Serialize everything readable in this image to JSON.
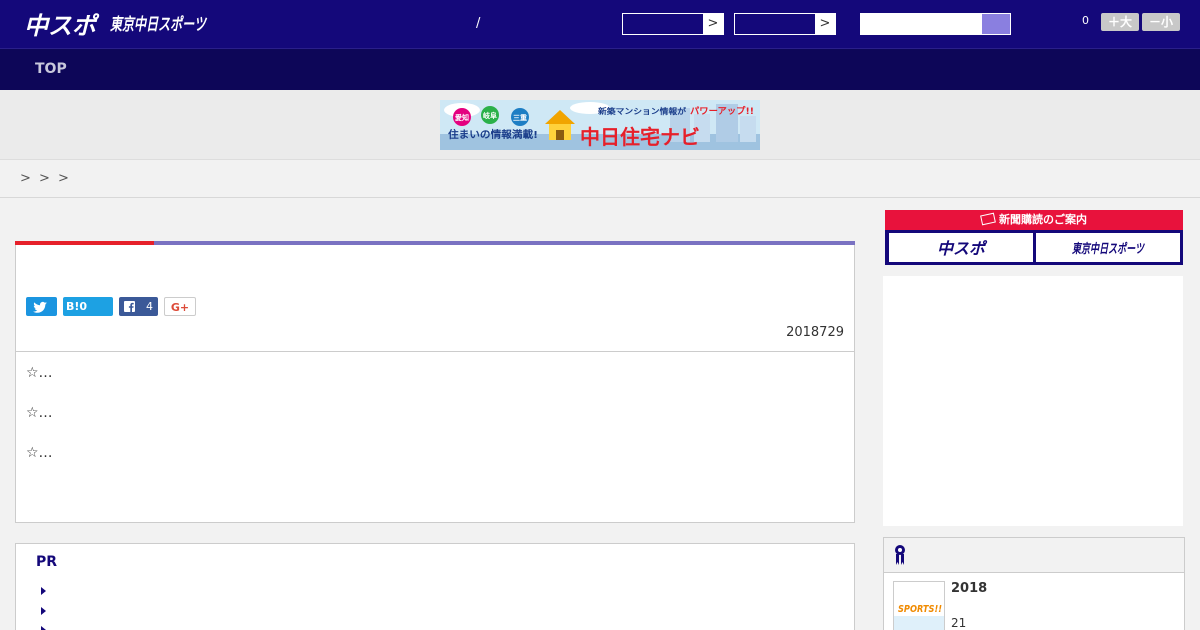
{
  "header": {
    "logo_main": "中スポ",
    "logo_tokyo": "東京中日スポーツ",
    "slash": "/",
    "select_arrow": ">",
    "font_count": "0",
    "font_up_label": "＋大",
    "font_down_label": "－小"
  },
  "nav": {
    "top_label": "TOP"
  },
  "banner": {
    "tag1": "愛知",
    "tag2": "岐阜",
    "tag3": "三重",
    "headline_top": "新築マンション情報が",
    "headline_accent": "パワーアップ!!",
    "tagline": "住まいの情報満載!",
    "brand": "中日住宅ナビ"
  },
  "breadcrumb": [
    ">",
    ">",
    ">"
  ],
  "article": {
    "date": "2018729",
    "hatena_label": "B!0",
    "fb_count": "4",
    "gplus_label": "G+",
    "lines": [
      "☆…",
      "☆…",
      "☆…"
    ]
  },
  "pr": {
    "title": "PR"
  },
  "sidebar": {
    "subscribe_header": "新聞購読のご案内",
    "subscribe_btn1": "中スポ",
    "subscribe_btn2": "東京中日スポーツ",
    "rank_year": "2018",
    "rank_sub": "21",
    "thumb_text": "SPORTS!!"
  },
  "colors": {
    "header_bg": "#14087a",
    "nav_bg": "#0d0658",
    "accent_red": "#e6202a",
    "accent_purple": "#7a72c2",
    "twitter": "#1b95e0",
    "hatena": "#1da1e3",
    "facebook": "#3b5998"
  }
}
